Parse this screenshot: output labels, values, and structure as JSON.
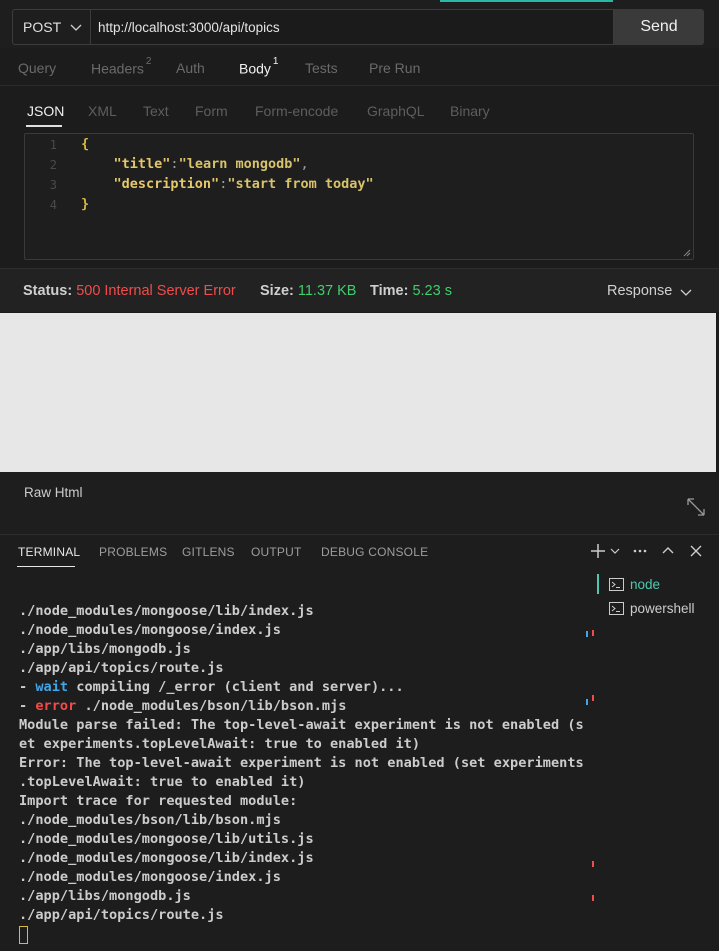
{
  "request": {
    "method": "POST",
    "url": "http://localhost:3000/api/topics",
    "send_label": "Send"
  },
  "tabs": {
    "query": "Query",
    "headers": "Headers",
    "headers_count": "2",
    "auth": "Auth",
    "body": "Body",
    "body_count": "1",
    "tests": "Tests",
    "prerun": "Pre Run"
  },
  "body_tabs": {
    "json": "JSON",
    "xml": "XML",
    "text": "Text",
    "form": "Form",
    "form_encode": "Form-encode",
    "graphql": "GraphQL",
    "binary": "Binary"
  },
  "editor": {
    "line_numbers": [
      "1",
      "2",
      "3",
      "4"
    ],
    "open_brace": "{",
    "key1": "\"title\"",
    "val1": "\"learn mongodb\"",
    "key2": "\"description\"",
    "val2": "\"start from today\"",
    "close_brace": "}"
  },
  "status": {
    "status_label": "Status:",
    "status_value": "500 Internal Server Error",
    "size_label": "Size:",
    "size_value": "11.37 KB",
    "time_label": "Time:",
    "time_value": "5.23 s",
    "response_label": "Response"
  },
  "raw_html_label": "Raw Html",
  "panel": {
    "tabs": [
      "TERMINAL",
      "PROBLEMS",
      "GITLENS",
      "OUTPUT",
      "DEBUG CONSOLE"
    ],
    "terminals": [
      "node",
      "powershell"
    ]
  },
  "terminal": {
    "l1": "./node_modules/mongoose/lib/index.js",
    "l2": "./node_modules/mongoose/index.js",
    "l3": "./app/libs/mongodb.js",
    "l4": "./app/api/topics/route.js",
    "l5_prefix": "- ",
    "l5_kw": "wait",
    "l5_rest": " compiling /_error (client and server)...",
    "l6_prefix": "- ",
    "l6_kw": "error",
    "l6_rest": " ./node_modules/bson/lib/bson.mjs",
    "l7": "Module parse failed: The top-level-await experiment is not enabled (s",
    "l8": "et experiments.topLevelAwait: true to enabled it)",
    "l9": "Error: The top-level-await experiment is not enabled (set experiments",
    "l10": ".topLevelAwait: true to enabled it)",
    "l11": "Import trace for requested module:",
    "l12": "./node_modules/bson/lib/bson.mjs",
    "l13": "./node_modules/mongoose/lib/utils.js",
    "l14": "./node_modules/mongoose/lib/index.js",
    "l15": "./node_modules/mongoose/index.js",
    "l16": "./app/libs/mongodb.js",
    "l17": "./app/api/topics/route.js"
  },
  "colors": {
    "accent": "#29b8a6",
    "error": "#f14c4c",
    "success": "#3ecf6b",
    "terminal_active": "#4ec9b0"
  }
}
